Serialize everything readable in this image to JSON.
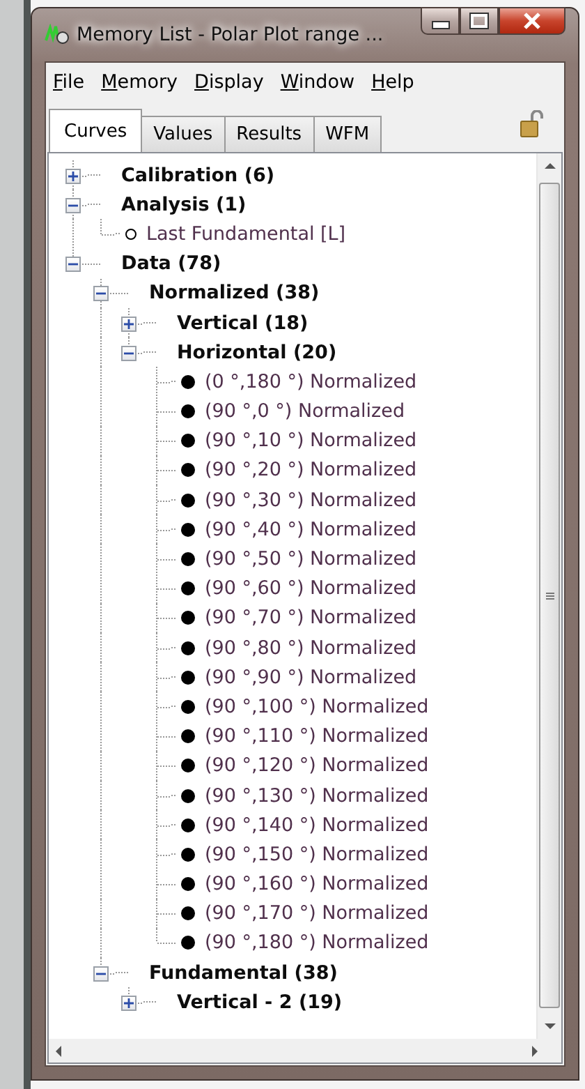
{
  "window": {
    "title": "Memory List - Polar Plot range ..."
  },
  "menu": [
    "File",
    "Memory",
    "Display",
    "Window",
    "Help"
  ],
  "tabs": [
    {
      "label": "Curves",
      "selected": true
    },
    {
      "label": "Values",
      "selected": false
    },
    {
      "label": "Results",
      "selected": false
    },
    {
      "label": "WFM",
      "selected": false
    }
  ],
  "lock": {
    "locked": false
  },
  "tree": [
    {
      "kind": "group",
      "label": "Calibration (6)",
      "expanded": false
    },
    {
      "kind": "group",
      "label": "Analysis (1)",
      "expanded": true,
      "children": [
        {
          "kind": "curve",
          "label": "Last Fundamental [L]",
          "filled": false
        }
      ]
    },
    {
      "kind": "group",
      "label": "Data (78)",
      "expanded": true,
      "children": [
        {
          "kind": "group",
          "label": "Normalized (38)",
          "expanded": true,
          "children": [
            {
              "kind": "group",
              "label": "Vertical (18)",
              "expanded": false
            },
            {
              "kind": "group",
              "label": "Horizontal (20)",
              "expanded": true,
              "children": [
                {
                  "kind": "curve",
                  "label": "(0 °,180 °) Normalized",
                  "filled": true
                },
                {
                  "kind": "curve",
                  "label": "(90 °,0 °) Normalized",
                  "filled": true
                },
                {
                  "kind": "curve",
                  "label": "(90 °,10 °) Normalized",
                  "filled": true
                },
                {
                  "kind": "curve",
                  "label": "(90 °,20 °) Normalized",
                  "filled": true
                },
                {
                  "kind": "curve",
                  "label": "(90 °,30 °) Normalized",
                  "filled": true
                },
                {
                  "kind": "curve",
                  "label": "(90 °,40 °) Normalized",
                  "filled": true
                },
                {
                  "kind": "curve",
                  "label": "(90 °,50 °) Normalized",
                  "filled": true
                },
                {
                  "kind": "curve",
                  "label": "(90 °,60 °) Normalized",
                  "filled": true
                },
                {
                  "kind": "curve",
                  "label": "(90 °,70 °) Normalized",
                  "filled": true
                },
                {
                  "kind": "curve",
                  "label": "(90 °,80 °) Normalized",
                  "filled": true
                },
                {
                  "kind": "curve",
                  "label": "(90 °,90 °) Normalized",
                  "filled": true
                },
                {
                  "kind": "curve",
                  "label": "(90 °,100 °) Normalized",
                  "filled": true
                },
                {
                  "kind": "curve",
                  "label": "(90 °,110 °) Normalized",
                  "filled": true
                },
                {
                  "kind": "curve",
                  "label": "(90 °,120 °) Normalized",
                  "filled": true
                },
                {
                  "kind": "curve",
                  "label": "(90 °,130 °) Normalized",
                  "filled": true
                },
                {
                  "kind": "curve",
                  "label": "(90 °,140 °) Normalized",
                  "filled": true
                },
                {
                  "kind": "curve",
                  "label": "(90 °,150 °) Normalized",
                  "filled": true
                },
                {
                  "kind": "curve",
                  "label": "(90 °,160 °) Normalized",
                  "filled": true
                },
                {
                  "kind": "curve",
                  "label": "(90 °,170 °) Normalized",
                  "filled": true
                },
                {
                  "kind": "curve",
                  "label": "(90 °,180 °) Normalized",
                  "filled": true
                }
              ]
            }
          ]
        },
        {
          "kind": "group",
          "label": "Fundamental (38)",
          "expanded": true,
          "children": [
            {
              "kind": "group",
              "label": "Vertical - 2 (19)",
              "expanded": false
            }
          ]
        }
      ]
    }
  ]
}
